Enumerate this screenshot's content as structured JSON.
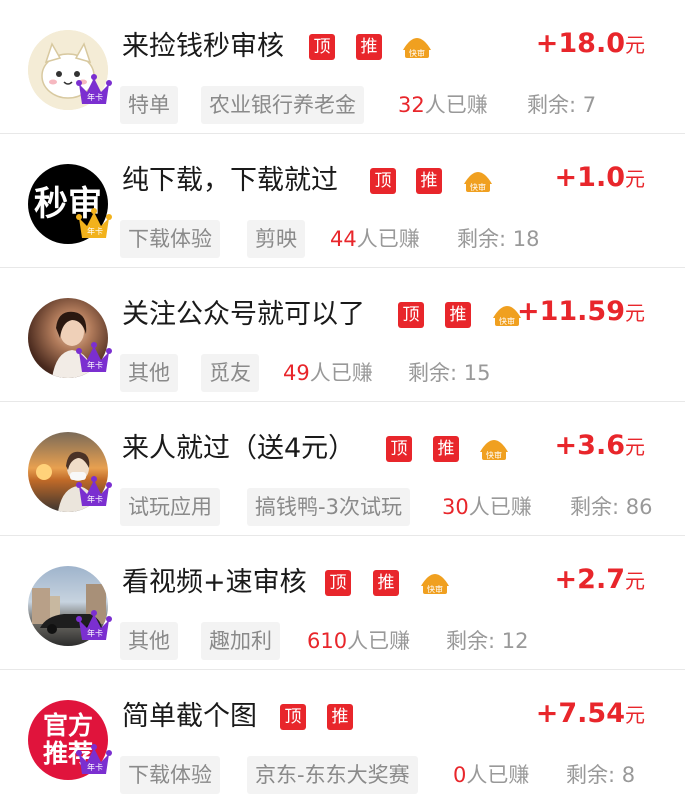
{
  "colors": {
    "accent": "#e8262b",
    "tag_bg": "#f3f3f3",
    "muted": "#999999"
  },
  "labels": {
    "top_badge": "顶",
    "rec_badge": "推",
    "fast_review": "快审",
    "annual_card": "年卡",
    "currency_unit": "元",
    "earned_suffix": "人已赚",
    "remaining_prefix": "剩余: "
  },
  "tasks": [
    {
      "title": "来捡钱秒审核",
      "reward": "+18.0",
      "fast_review": true,
      "tags": [
        "特单",
        "农业银行养老金"
      ],
      "earned": "32",
      "remaining": "7",
      "avatar": {
        "style": "cartoon-cat",
        "text": "",
        "bg": "#f3ead0"
      }
    },
    {
      "title": "纯下载，下载就过",
      "reward": "+1.0",
      "fast_review": true,
      "tags": [
        "下载体验",
        "剪映"
      ],
      "earned": "44",
      "remaining": "18",
      "avatar": {
        "style": "text",
        "text": "秒审",
        "bg": "#000000"
      }
    },
    {
      "title": "关注公众号就可以了",
      "reward": "+11.59",
      "fast_review": true,
      "tags": [
        "其他",
        "觅友"
      ],
      "earned": "49",
      "remaining": "15",
      "avatar": {
        "style": "photo",
        "text": "",
        "bg": "#5a3a2a"
      }
    },
    {
      "title": "来人就过（送4元）",
      "reward": "+3.6",
      "fast_review": true,
      "tags": [
        "试玩应用",
        "搞钱鸭-3次试玩"
      ],
      "earned": "30",
      "remaining": "86",
      "avatar": {
        "style": "photo",
        "text": "",
        "bg": "#d08a40"
      }
    },
    {
      "title": "看视频+速审核",
      "reward": "+2.7",
      "fast_review": true,
      "tags": [
        "其他",
        "趣加利"
      ],
      "earned": "610",
      "remaining": "12",
      "avatar": {
        "style": "photo",
        "text": "",
        "bg": "#7a8fa8"
      }
    },
    {
      "title": "简单截个图",
      "reward": "+7.54",
      "fast_review": false,
      "tags": [
        "下载体验",
        "京东-东东大奖赛"
      ],
      "earned": "0",
      "remaining": "8",
      "avatar": {
        "style": "text",
        "text": "官方推荐",
        "bg": "#e0143c"
      }
    }
  ]
}
